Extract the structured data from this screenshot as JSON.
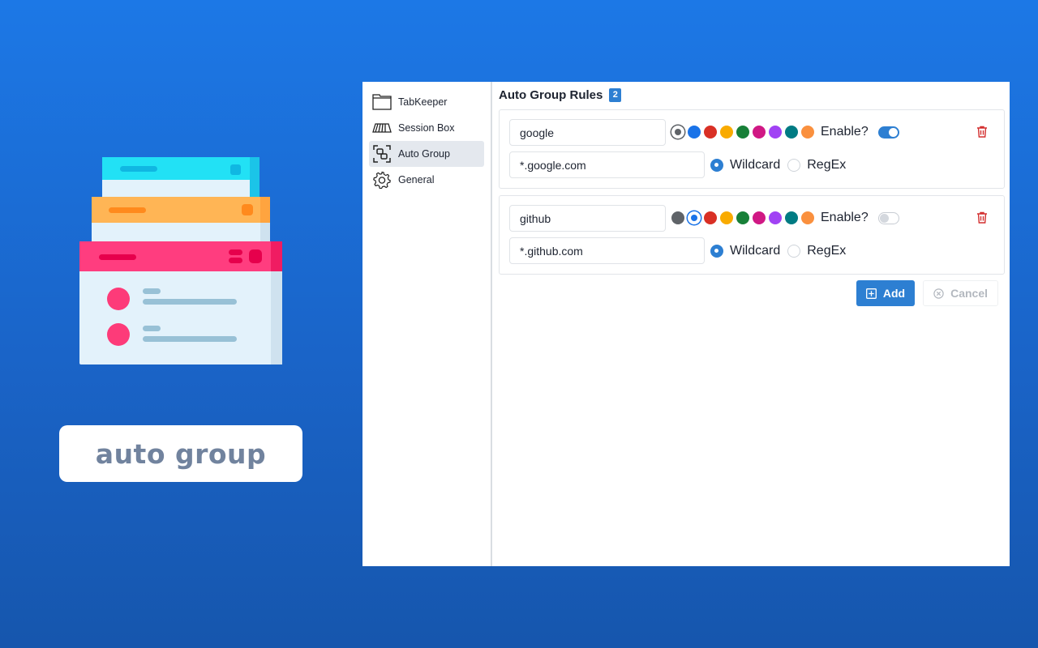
{
  "caption": "auto group",
  "sidebar": {
    "items": [
      {
        "label": "TabKeeper",
        "icon": "folder-icon"
      },
      {
        "label": "Session Box",
        "icon": "session-box-icon"
      },
      {
        "label": "Auto Group",
        "icon": "group-icon",
        "active": true
      },
      {
        "label": "General",
        "icon": "gear-icon"
      }
    ]
  },
  "main": {
    "title": "Auto Group Rules",
    "count": "2",
    "enable_label": "Enable?",
    "match_types": [
      "Wildcard",
      "RegEx"
    ],
    "rules": [
      {
        "name": "google",
        "pattern": "*.google.com",
        "color_selected": "grey",
        "enabled": true,
        "match": "Wildcard"
      },
      {
        "name": "github",
        "pattern": "*.github.com",
        "color_selected": "blue",
        "enabled": false,
        "match": "Wildcard"
      }
    ],
    "colors": [
      {
        "name": "grey",
        "hex": "#5f6368"
      },
      {
        "name": "blue",
        "hex": "#1a73e8"
      },
      {
        "name": "red",
        "hex": "#d93025"
      },
      {
        "name": "yellow",
        "hex": "#f9ab00"
      },
      {
        "name": "green",
        "hex": "#188038"
      },
      {
        "name": "pink",
        "hex": "#d01884"
      },
      {
        "name": "purple",
        "hex": "#a142f4"
      },
      {
        "name": "cyan",
        "hex": "#007b83"
      },
      {
        "name": "orange",
        "hex": "#fa903e"
      }
    ],
    "add_label": "Add",
    "cancel_label": "Cancel"
  }
}
